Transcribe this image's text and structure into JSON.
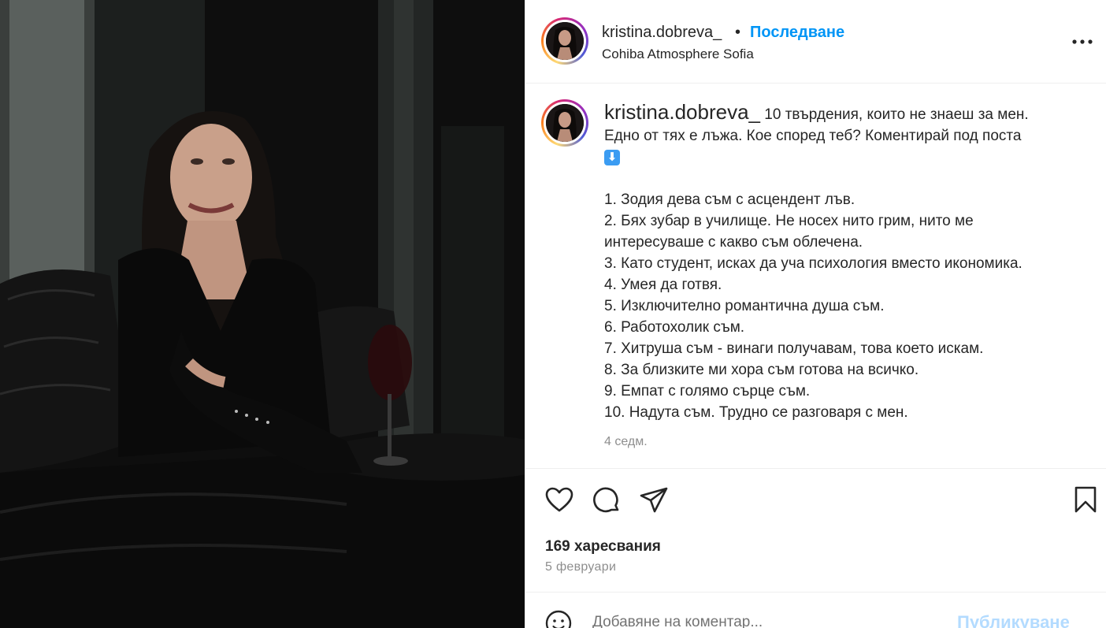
{
  "post": {
    "username": "kristina.dobreva_",
    "dot": "•",
    "follow_label": "Последване",
    "location": "Cohiba Atmosphere Sofia"
  },
  "caption": {
    "username": "kristina.dobreva_",
    "line1": "10 твърдения, които не знаеш за мен.",
    "line2": "Едно от тях е лъжа. Кое според теб? Коментирай под поста",
    "emoji": "⬇",
    "items": [
      "1. Зодия дева съм с асцендент лъв.",
      "2. Бях зубар в училище. Не носех нито грим, нито ме",
      "интересуваше с какво съм облечена.",
      "3. Като студент, исках да уча психология вместо икономика.",
      "4. Умея да готвя.",
      "5. Изключително романтична душа съм.",
      "6. Работохолик съм.",
      "7. Хитруша съм - винаги получавам, това което искам.",
      "8. За близките ми хора съм готова на всичко.",
      "9. Емпат с голямо сърце съм.",
      "10. Надута съм. Трудно се разговаря с мен."
    ],
    "time": "4 седм."
  },
  "stats": {
    "likes": "169 харесвания",
    "date": "5 февруари"
  },
  "comment": {
    "placeholder": "Добавяне на коментар...",
    "publish_label": "Публикуване"
  },
  "icons": {
    "more": "more-options-icon",
    "like": "heart-icon",
    "comment": "comment-icon",
    "share": "share-icon",
    "save": "bookmark-icon",
    "emoji": "smile-icon"
  },
  "colors": {
    "accent": "#0095f6",
    "publish_disabled": "#b3dbff",
    "muted": "#8e8e8e"
  }
}
